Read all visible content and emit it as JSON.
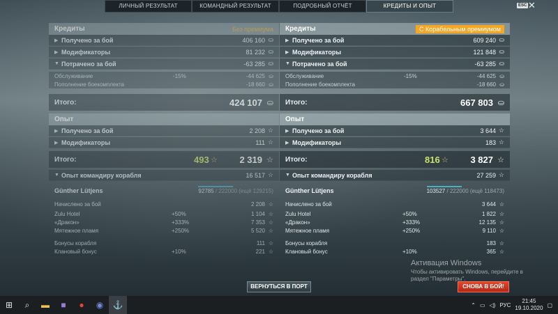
{
  "tabs": [
    "ЛИЧНЫЙ РЕЗУЛЬТАТ",
    "КОМАНДНЫЙ РЕЗУЛЬТАТ",
    "ПОДРОБНЫЙ ОТЧЁТ",
    "КРЕДИТЫ И ОПЫТ"
  ],
  "esc_label": "ESC",
  "left": {
    "credits_title": "Кредиты",
    "premium_label": "Без премиума",
    "credits_rows": [
      {
        "label": "Получено за бой",
        "value": "406 160"
      },
      {
        "label": "Модификаторы",
        "value": "81 232"
      },
      {
        "label": "Потрачено за бой",
        "value": "-63 285"
      }
    ],
    "spent_sub": [
      {
        "label": "Обслуживание",
        "pct": "-15%",
        "value": "-44 625"
      },
      {
        "label": "Пополнение боекомплекта",
        "pct": "",
        "value": "-18 660"
      }
    ],
    "credits_total_label": "Итого:",
    "credits_total": "424 107",
    "xp_title": "Опыт",
    "xp_rows": [
      {
        "label": "Получено за бой",
        "value": "2 208"
      },
      {
        "label": "Модификаторы",
        "value": "111"
      }
    ],
    "xp_total_label": "Итого:",
    "xp_free": "493",
    "xp_total": "2 319",
    "cmd_row": {
      "label": "Опыт командиру корабля",
      "value": "16 517"
    },
    "captain": {
      "name": "Günther Lütjens",
      "progress": "92785",
      "max": "/ 222000 (ещё 129215)"
    },
    "cmd_lines": [
      {
        "label": "Начислено за бой",
        "pct": "",
        "value": "2 208"
      },
      {
        "label": "Zulu Hotel",
        "pct": "+50%",
        "value": "1 104"
      },
      {
        "label": "«Дракон»",
        "pct": "+333%",
        "value": "7 353"
      },
      {
        "label": "Мятежное пламя",
        "pct": "+250%",
        "value": "5 520"
      },
      {
        "label": "Бонусы корабля",
        "pct": "",
        "value": "111"
      },
      {
        "label": "Клановый бонус",
        "pct": "+10%",
        "value": "221"
      }
    ]
  },
  "right": {
    "credits_title": "Кредиты",
    "premium_label": "С Корабельным премиумом",
    "credits_rows": [
      {
        "label": "Получено за бой",
        "value": "609 240"
      },
      {
        "label": "Модификаторы",
        "value": "121 848"
      },
      {
        "label": "Потрачено за бой",
        "value": "-63 285"
      }
    ],
    "spent_sub": [
      {
        "label": "Обслуживание",
        "pct": "-15%",
        "value": "-44 625"
      },
      {
        "label": "Пополнение боекомплекта",
        "pct": "",
        "value": "-18 660"
      }
    ],
    "credits_total_label": "Итого:",
    "credits_total": "667 803",
    "xp_title": "Опыт",
    "xp_rows": [
      {
        "label": "Получено за бой",
        "value": "3 644"
      },
      {
        "label": "Модификаторы",
        "value": "183"
      }
    ],
    "xp_total_label": "Итого:",
    "xp_free": "816",
    "xp_total": "3 827",
    "cmd_row": {
      "label": "Опыт командиру корабля",
      "value": "27 259"
    },
    "captain": {
      "name": "Günther Lütjens",
      "progress": "103527",
      "max": "/ 222000 (ещё 118473)"
    },
    "cmd_lines": [
      {
        "label": "Начислено за бой",
        "pct": "",
        "value": "3 644"
      },
      {
        "label": "Zulu Hotel",
        "pct": "+50%",
        "value": "1 822"
      },
      {
        "label": "«Дракон»",
        "pct": "+333%",
        "value": "12 135"
      },
      {
        "label": "Мятежное пламя",
        "pct": "+250%",
        "value": "9 110"
      },
      {
        "label": "Бонусы корабля",
        "pct": "",
        "value": "183"
      },
      {
        "label": "Клановый бонус",
        "pct": "+10%",
        "value": "365"
      }
    ]
  },
  "buttons": {
    "to_port": "ВЕРНУТЬСЯ В ПОРТ",
    "battle_again": "СНОВА В БОЙ!"
  },
  "watermark": {
    "line1": "Активация Windows",
    "line2": "Чтобы активировать Windows, перейдите в",
    "line3": "раздел \"Параметры\"."
  },
  "taskbar": {
    "lang": "РУС",
    "time": "21:45",
    "date": "19.10.2020"
  },
  "icons": {
    "credit": "credit-coin-icon",
    "xp": "star-icon"
  },
  "colors": {
    "premium_accent": "#f5a623",
    "free_xp": "#c9e36a",
    "fight_button": "#d1351f"
  }
}
